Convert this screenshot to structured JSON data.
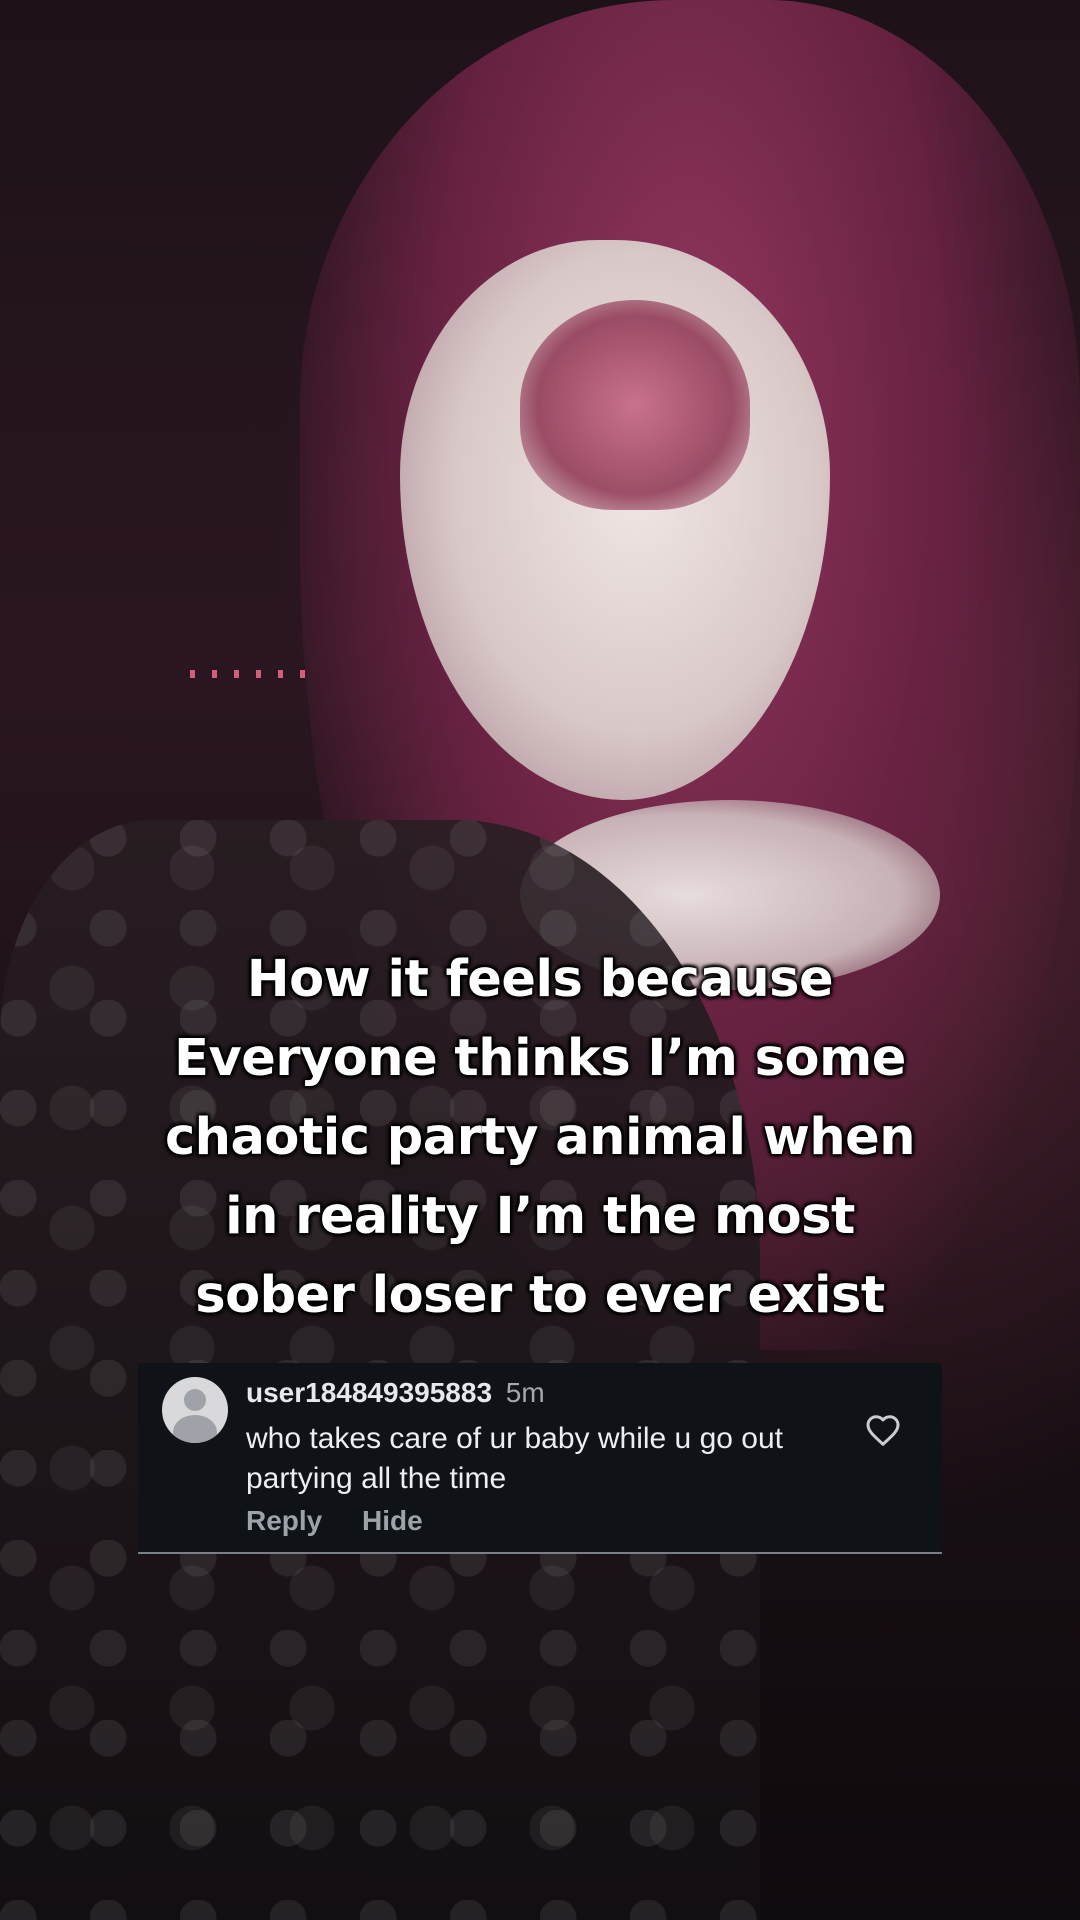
{
  "caption": {
    "lines": [
      "How it feels because",
      "Everyone thinks I’m some",
      "chaotic party animal when",
      "in reality I’m the most",
      "sober loser to ever exist"
    ]
  },
  "comment": {
    "username": "user184849395883",
    "time": "5m",
    "text": "who takes care of ur baby while u go out partying all the time",
    "reply_label": "Reply",
    "hide_label": "Hide",
    "avatar_icon": "default-avatar-icon",
    "like_icon": "heart-outline-icon"
  },
  "colors": {
    "card_background": "#0f1216",
    "caption_text": "#ffffff",
    "action_text": "#9ea3aa"
  }
}
